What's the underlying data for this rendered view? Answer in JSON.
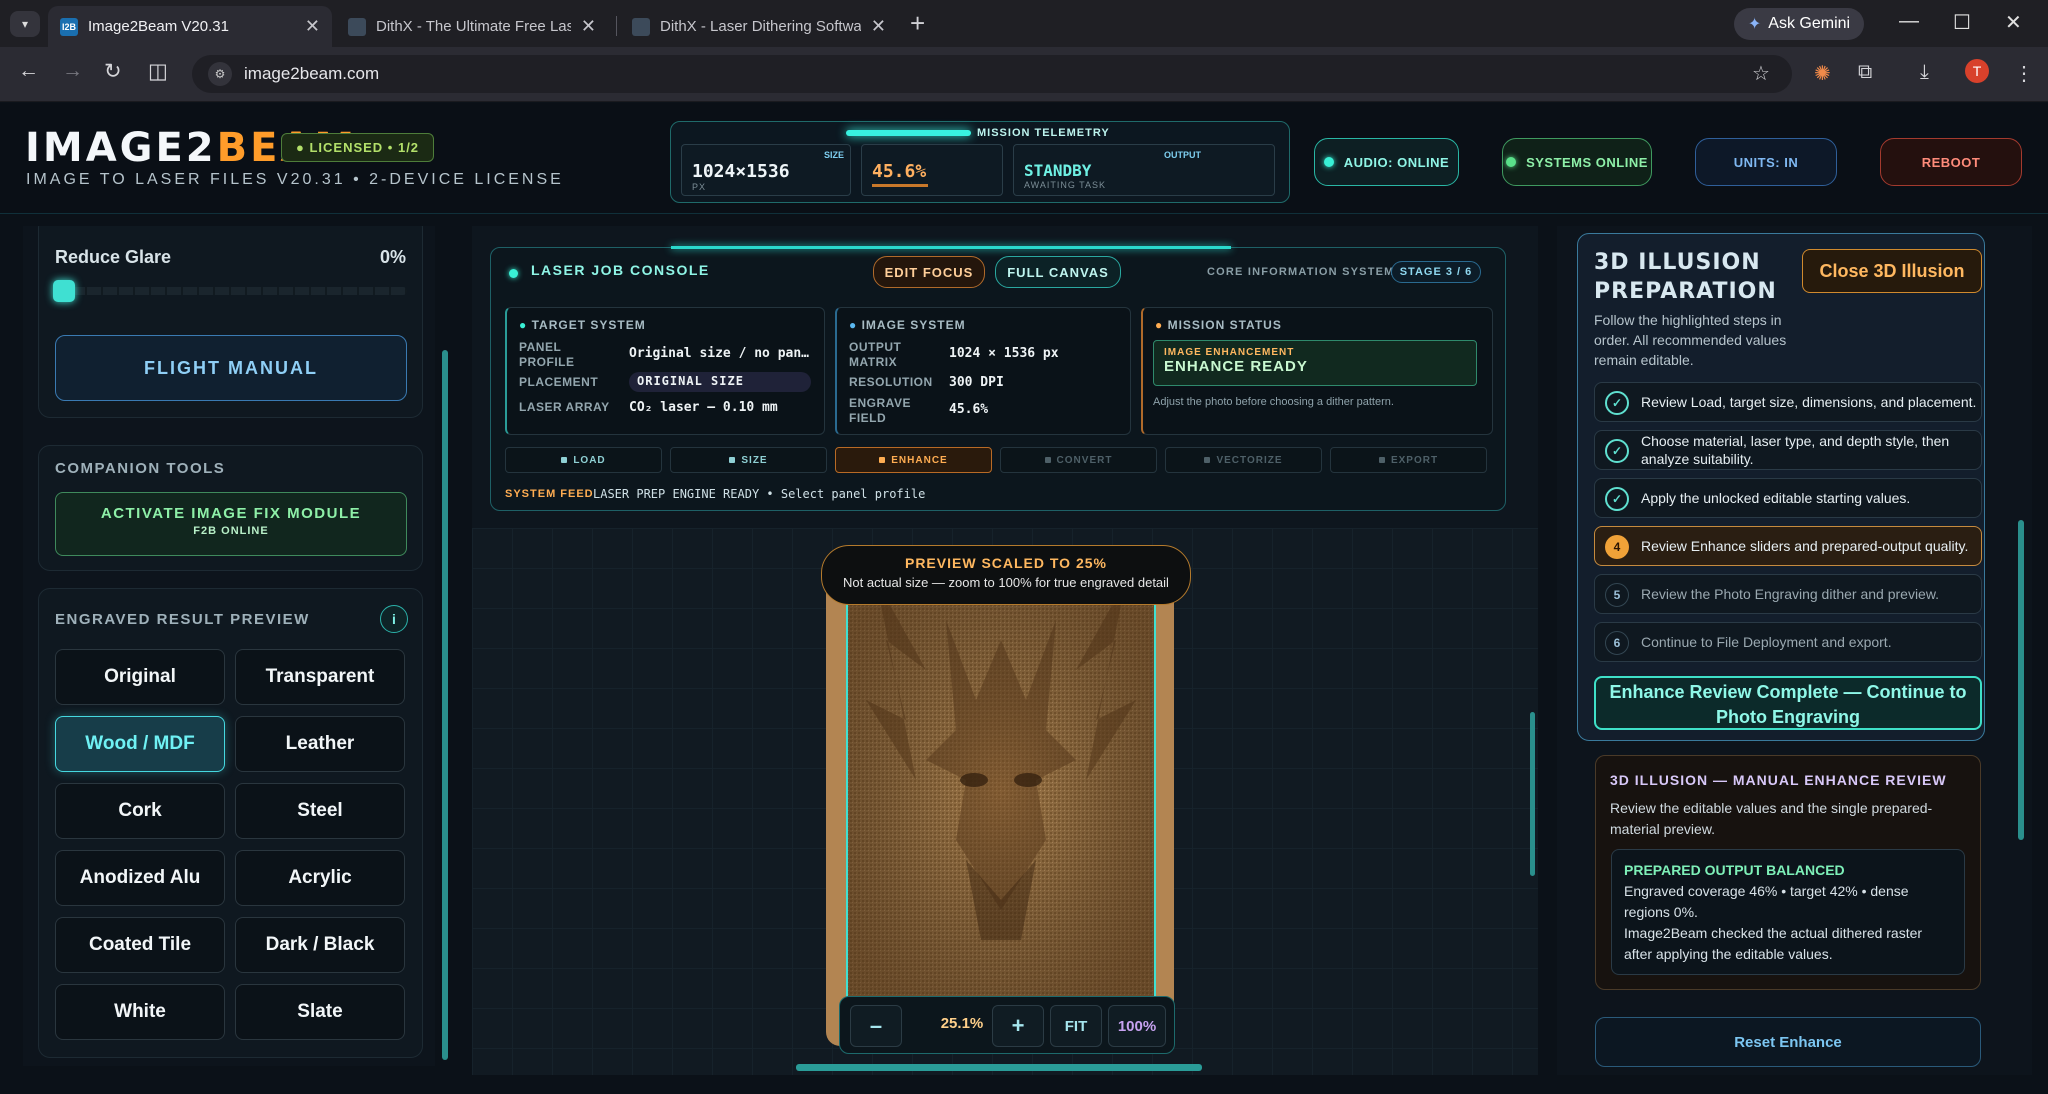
{
  "browser": {
    "tabs": [
      {
        "title": "Image2Beam V20.31",
        "active": true
      },
      {
        "title": "DithX - The Ultimate Free Laser",
        "active": false
      },
      {
        "title": "DithX - Laser Dithering Softwar",
        "active": false
      }
    ],
    "ask_gemini": "Ask Gemini",
    "url": "image2beam.com",
    "avatar_letter": "T"
  },
  "header": {
    "logo_main": "IMAGE2",
    "logo_accent": "BEAM",
    "license": "● LICENSED • 1/2",
    "subtitle": "IMAGE TO LASER FILES V20.31 • 2-DEVICE LICENSE",
    "telemetry": {
      "title": "MISSION TELEMETRY",
      "size_label": "SIZE",
      "size_value": "1024×1536",
      "size_unit": "PX",
      "coverage_value": "45.6%",
      "output_label": "OUTPUT",
      "output_value": "STANDBY",
      "output_sub": "AWAITING TASK"
    },
    "pills": {
      "audio": "AUDIO: ONLINE",
      "systems": "SYSTEMS ONLINE",
      "units": "UNITS: IN",
      "reboot": "REBOOT"
    }
  },
  "left": {
    "reduce_glare_label": "Reduce Glare",
    "reduce_glare_value": "0%",
    "reduce_glare_level": 0,
    "flight_manual": "FLIGHT MANUAL",
    "companion_title": "COMPANION TOOLS",
    "activate_label": "ACTIVATE IMAGE FIX MODULE",
    "activate_sub": "F2B ONLINE",
    "preview_title": "ENGRAVED RESULT PREVIEW",
    "info": "i",
    "materials": [
      "Original",
      "Transparent",
      "Wood / MDF",
      "Leather",
      "Cork",
      "Steel",
      "Anodized Alu",
      "Acrylic",
      "Coated Tile",
      "Dark / Black",
      "White",
      "Slate"
    ],
    "selected_material": "Wood / MDF"
  },
  "console": {
    "title": "LASER JOB CONSOLE",
    "edit_focus": "EDIT FOCUS",
    "full_canvas": "FULL CANVAS",
    "core_label": "CORE INFORMATION SYSTEM",
    "stage": "STAGE 3 / 6",
    "target": {
      "head": "TARGET SYSTEM",
      "panel_profile_label": "PANEL PROFILE",
      "panel_profile_value": "Original size / no pan…",
      "placement_label": "PLACEMENT",
      "placement_value": "ORIGINAL SIZE",
      "laser_array_label": "LASER ARRAY",
      "laser_array_value": "CO₂ laser — 0.10 mm"
    },
    "image": {
      "head": "IMAGE SYSTEM",
      "output_matrix_label": "OUTPUT MATRIX",
      "output_matrix_value": "1024 × 1536 px",
      "resolution_label": "RESOLUTION",
      "resolution_value": "300 DPI",
      "engrave_field_label": "ENGRAVE FIELD",
      "engrave_field_value": "45.6%"
    },
    "mission": {
      "head": "MISSION STATUS",
      "badge_label": "IMAGE ENHANCEMENT",
      "badge_value": "ENHANCE READY",
      "note": "Adjust the photo before choosing a dither pattern."
    },
    "stages": [
      "LOAD",
      "SIZE",
      "ENHANCE",
      "CONVERT",
      "VECTORIZE",
      "EXPORT"
    ],
    "feed_label": "SYSTEM FEED",
    "feed_text": "LASER PREP ENGINE READY • Select panel profile"
  },
  "canvas": {
    "preview_title": "PREVIEW SCALED TO 25%",
    "preview_sub": "Not actual size — zoom to 100% for true engraved detail",
    "zoom_minus": "–",
    "zoom_value": "25.1%",
    "zoom_plus": "+",
    "fit": "FIT",
    "hundred": "100%"
  },
  "right": {
    "illusion_title": "3D ILLUSION PREPARATION",
    "close_btn": "Close 3D Illusion",
    "intro": "Follow the highlighted steps in order. All recommended values remain editable.",
    "steps": [
      {
        "badge": "✓",
        "text": "Review Load, target size, dimensions, and placement."
      },
      {
        "badge": "✓",
        "text": "Choose material, laser type, and depth style, then analyze suitability."
      },
      {
        "badge": "✓",
        "text": "Apply the unlocked editable starting values."
      },
      {
        "badge": "4",
        "text": "Review Enhance sliders and prepared-output quality."
      },
      {
        "badge": "5",
        "text": "Review the Photo Engraving dither and preview."
      },
      {
        "badge": "6",
        "text": "Continue to File Deployment and export."
      }
    ],
    "continue_btn": "Enhance Review Complete — Continue to Photo Engraving",
    "manual_title": "3D ILLUSION — MANUAL ENHANCE REVIEW",
    "manual_desc": "Review the editable values and the single prepared-material preview.",
    "prepared_title": "PREPARED OUTPUT BALANCED",
    "prepared_line1": "Engraved coverage 46% • target 42% • dense regions 0%.",
    "prepared_line2": "Image2Beam checked the actual dithered raster after applying the editable values.",
    "reset_btn": "Reset Enhance"
  }
}
